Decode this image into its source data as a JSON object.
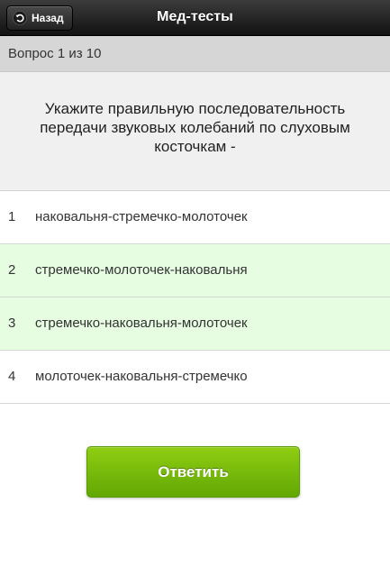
{
  "header": {
    "back_label": "Назад",
    "back_icon": "undo-arrow-icon",
    "title": "Мед-тесты"
  },
  "counter": {
    "text": "Вопрос 1 из 10"
  },
  "question": {
    "text": "Укажите правильную последовательность передачи звуковых колебаний по слуховым косточкам -"
  },
  "answers": [
    {
      "number": "1",
      "text": "наковальня-стремечко-молоточек",
      "highlighted": false
    },
    {
      "number": "2",
      "text": "стремечко-молоточек-наковальня",
      "highlighted": true
    },
    {
      "number": "3",
      "text": "стремечко-наковальня-молоточек",
      "highlighted": true
    },
    {
      "number": "4",
      "text": "молоточек-наковальня-стремечко",
      "highlighted": false
    }
  ],
  "submit": {
    "label": "Ответить"
  },
  "colors": {
    "header_bg": "#1e1e1e",
    "counter_bg": "#d6d6d6",
    "question_bg": "#f0f0f0",
    "answer_highlight_bg": "#e6fde2",
    "submit_green": "#78bb0b"
  }
}
